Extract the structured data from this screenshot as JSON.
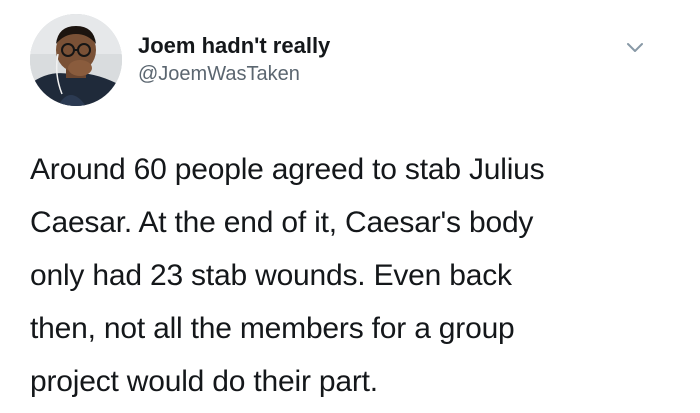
{
  "tweet": {
    "display_name": "Joem hadn't really",
    "handle": "@JoemWasTaken",
    "avatar_icon": "profile-photo",
    "menu_icon": "chevron-down-icon",
    "text_lines": [
      "Around 60 people agreed to stab Julius",
      "Caesar. At the end of it, Caesar's body",
      "only had 23 stab wounds. Even back",
      "then, not all the members for a group",
      "project would do their part."
    ]
  },
  "colors": {
    "text": "#14171a",
    "secondary_text": "#5b6670",
    "background": "#ffffff"
  }
}
